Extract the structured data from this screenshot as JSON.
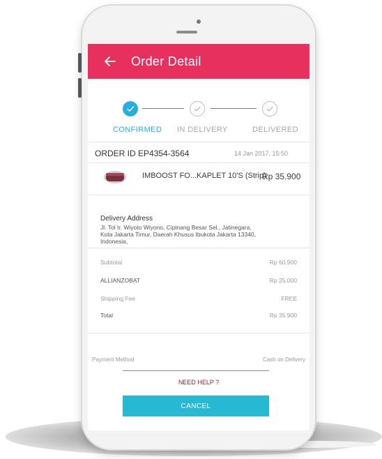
{
  "app": {
    "title": "Order Detail"
  },
  "progress": {
    "current_step": 1,
    "steps": [
      {
        "label": "CONFIRMED",
        "state": "done"
      },
      {
        "label": "IN DELIVERY",
        "state": "pending"
      },
      {
        "label": "DELIVERED",
        "state": "pending"
      }
    ]
  },
  "order": {
    "id_label": "ORDER ID",
    "id": "EP4354-3564",
    "date": "14 Jan 2017, 15:50"
  },
  "product": {
    "name": "IMBOOST FO...KAPLET 10'S",
    "unit": "(Strip)",
    "price": "Rp 35.900"
  },
  "delivery": {
    "label": "Delivery Address",
    "address": "Jl. Tol Ir. Wiyoto Wiyono, Cipinang Besar Sel., Jatinegara, Kota Jakarta Timur, Daerah Khusus Ibukota Jakarta 13340, Indonesia,"
  },
  "summary": {
    "rows": [
      {
        "label": "Subtotal",
        "value": "Rp 60.900"
      },
      {
        "label": "ALLIANZOBAT",
        "value": "Rp 25.000"
      },
      {
        "label": "Shipping Fee",
        "value": "FREE"
      },
      {
        "label": "Total",
        "value": "Rp 35.900"
      }
    ]
  },
  "payment": {
    "label": "Payment Method",
    "value": "Cash on Delivery"
  },
  "help": {
    "label": "NEED HELP ?"
  },
  "cancel": {
    "label": "CANCEL"
  },
  "colors": {
    "accent": "#e8305f",
    "primary": "#27aee0",
    "button": "#27b8d4"
  },
  "icons": {
    "back": "arrow-left-icon",
    "check": "check-icon"
  }
}
